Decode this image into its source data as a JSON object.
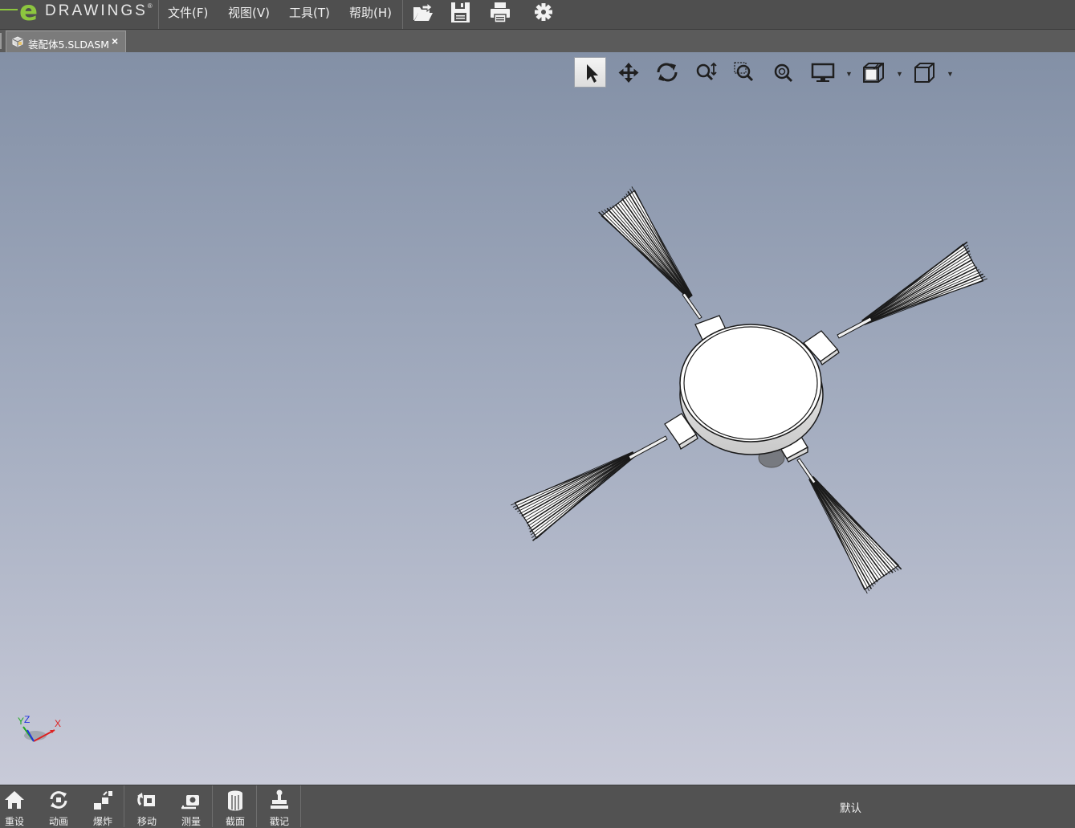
{
  "app": {
    "logo_e": "e",
    "logo_text": "DRAWINGS",
    "logo_mark": "®"
  },
  "menu": [
    {
      "label": "文件(F)"
    },
    {
      "label": "视图(V)"
    },
    {
      "label": "工具(T)"
    },
    {
      "label": "帮助(H)"
    }
  ],
  "toolbar_icons": [
    "open-icon",
    "save-icon",
    "print-icon",
    "settings-gear-icon"
  ],
  "tab": {
    "label": "装配体5.SLDASM",
    "close": "×",
    "icon": "assembly-icon"
  },
  "view_toolbar": {
    "items": [
      "select-icon",
      "pan-icon",
      "rotate-icon",
      "zoom-icon",
      "zoom-to-area-icon",
      "zoom-to-fit-icon",
      "display-style-icon",
      "section-view-icon",
      "view-orientation-icon"
    ],
    "active": "select-icon"
  },
  "triad": {
    "x_label": "X",
    "y_label": "Y",
    "z_label": "Z"
  },
  "bottom_toolbar": [
    {
      "label": "重设",
      "icon": "home-icon"
    },
    {
      "label": "动画",
      "icon": "animate-icon"
    },
    {
      "label": "爆炸",
      "icon": "explode-icon"
    },
    {
      "label": "移动",
      "icon": "move-icon"
    },
    {
      "label": "测量",
      "icon": "measure-icon"
    },
    {
      "label": "截面",
      "icon": "section-icon"
    },
    {
      "label": "戳记",
      "icon": "stamp-icon"
    }
  ],
  "status": {
    "configuration": "默认"
  },
  "colors": {
    "menu_bg": "#4f4f4f",
    "brand_green": "#8dc63f",
    "viewport_top": "#8390a6",
    "viewport_bottom": "#c8cad8"
  }
}
